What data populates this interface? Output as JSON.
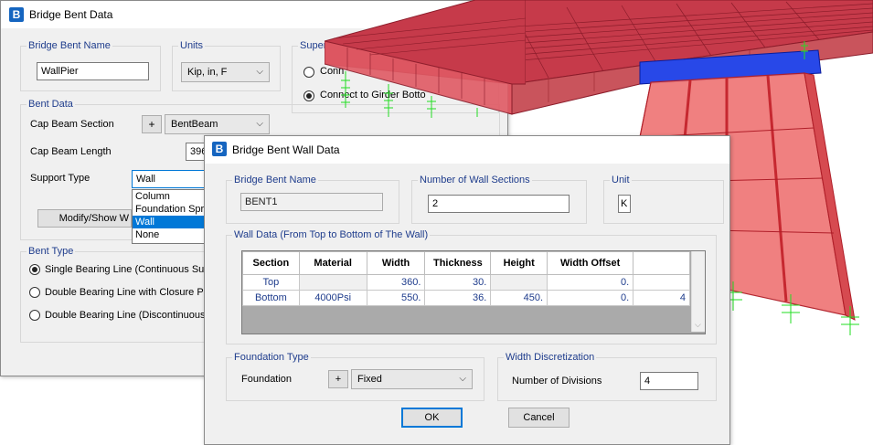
{
  "bent_window": {
    "title": "Bridge Bent Data",
    "name_group": "Bridge Bent Name",
    "name_value": "WallPier",
    "units_group": "Units",
    "units_value": "Kip, in, F",
    "super_group": "Superstru",
    "connect_opt1": "Conn",
    "connect_opt2": "Connect to Girder Botto",
    "bent_data_group": "Bent Data",
    "cap_section_label": "Cap Beam Section",
    "cap_section_value": "BentBeam",
    "cap_length_label": "Cap Beam Length",
    "cap_length_value": "396",
    "support_type_label": "Support Type",
    "support_type_value": "Wall",
    "support_options": [
      "Column",
      "Foundation Spri",
      "Wall",
      "None"
    ],
    "modify_button": "Modify/Show W",
    "bent_type_group": "Bent Type",
    "bent_types": [
      "Single Bearing Line  (Continuous Sup",
      "Double Bearing Line with Closure Po",
      "Double Bearing Line  (Discontinuous"
    ]
  },
  "wall_window": {
    "title": "Bridge Bent Wall Data",
    "name_group": "Bridge Bent Name",
    "name_value": "BENT1",
    "sections_group": "Number of Wall Sections",
    "sections_value": "2",
    "units_group": "Unit",
    "units_value": "K",
    "wall_data_group": "Wall Data (From Top to Bottom of The Wall)",
    "columns": [
      "Section",
      "Material",
      "Width",
      "Thickness",
      "Height",
      "Width Offset"
    ],
    "rows": [
      [
        "Top",
        "",
        "360.",
        "30.",
        "",
        "0.",
        ""
      ],
      [
        "Bottom",
        "4000Psi",
        "550.",
        "36.",
        "450.",
        "0.",
        "4"
      ]
    ],
    "foundation_group": "Foundation Type",
    "foundation_label": "Foundation",
    "foundation_value": "Fixed",
    "discretization_group": "Width Discretization",
    "divisions_label": "Number of Divisions",
    "divisions_value": "4",
    "ok_button": "OK",
    "cancel_button": "Cancel"
  },
  "icons": {
    "app_icon": "B",
    "plus": "+",
    "chevron": "⌵",
    "close": "×"
  },
  "colors": {
    "accent": "#1565c0",
    "group_label": "#1e3c8c",
    "selection": "#0078d7",
    "model_red": "#e53935",
    "model_blue": "#1e3ee8",
    "spring_green": "#22dd22"
  }
}
